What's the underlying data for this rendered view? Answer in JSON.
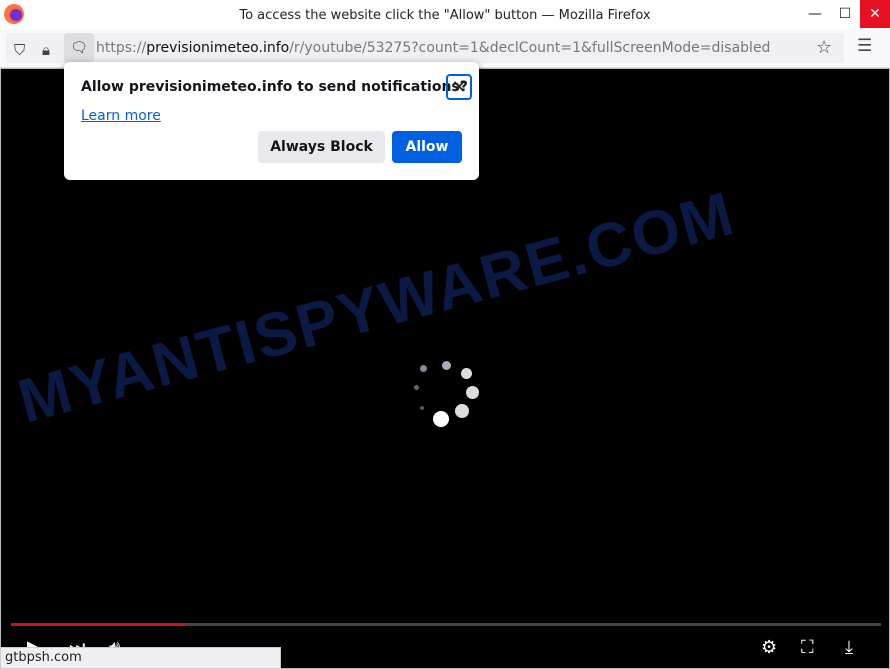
{
  "window": {
    "title": "To access the website click the \"Allow\" button — Mozilla Firefox",
    "minimize": "—",
    "maximize": "☐",
    "close": "✕"
  },
  "urlbar": {
    "scheme": "https://",
    "domain": "previsionimeteo.info",
    "path": "/r/youtube/53275?count=1&declCount=1&fullScreenMode=disabled"
  },
  "popup": {
    "title": "Allow previsionimeteo.info to send notifications?",
    "learn_more": "Learn more",
    "block_label": "Always Block",
    "allow_label": "Allow"
  },
  "watermark": "MYANTISPYWARE.COM",
  "player": {
    "progress_percent": 20
  },
  "status_text": "gtbpsh.com",
  "colors": {
    "accent": "#0061e0",
    "progress": "#c4161c",
    "close": "#e81123"
  }
}
